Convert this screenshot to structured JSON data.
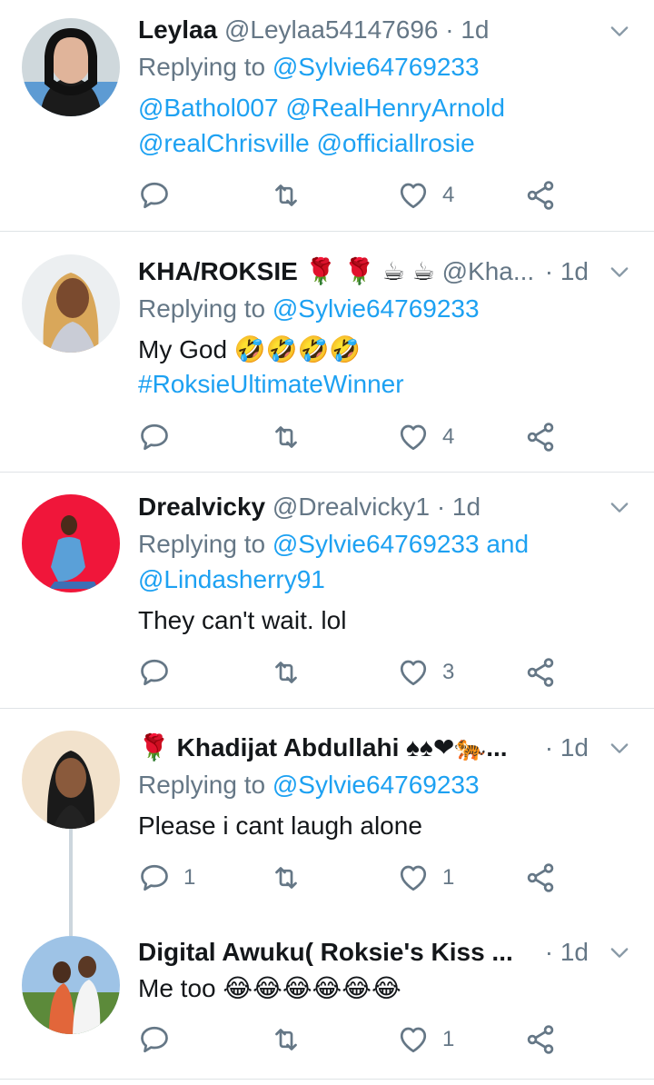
{
  "tweets": [
    {
      "name": "Leylaa",
      "handle": "@Leylaa54147696",
      "time": "· 1d",
      "replying_prefix": "Replying to",
      "replying_to": "@Sylvie64769233",
      "lines": [
        "@Bathol007 @RealHenryArnold",
        "@realChrisville @officiallrosie"
      ],
      "reply_count": "",
      "retweet_count": "",
      "like_count": "4"
    },
    {
      "name": "KHA/ROKSIE 🌹 🌹 ☕ ☕",
      "handle": "@Kha...",
      "time": "· 1d",
      "replying_prefix": "Replying to",
      "replying_to": "@Sylvie64769233",
      "text": "My God 🤣🤣🤣🤣",
      "hashtag": "#RoksieUltimateWinner",
      "reply_count": "",
      "retweet_count": "",
      "like_count": "4"
    },
    {
      "name": "Drealvicky",
      "handle": "@Drealvicky1",
      "time": "· 1d",
      "replying_prefix": "Replying to",
      "replying_to": "@Sylvie64769233 and",
      "replying_to_2": "@Lindasherry91",
      "text": "They can't wait. lol",
      "reply_count": "",
      "retweet_count": "",
      "like_count": "3"
    },
    {
      "name": "🌹 Khadijat Abdullahi ♠♠❤🐅...",
      "time": "· 1d",
      "replying_prefix": "Replying to",
      "replying_to": "@Sylvie64769233",
      "text": "Please i cant laugh alone",
      "reply_count": "1",
      "retweet_count": "",
      "like_count": "1"
    },
    {
      "name": "Digital Awuku( Roksie's Kiss ...",
      "time": "· 1d",
      "text": "Me too 😂😂😂😂😂😂",
      "reply_count": "",
      "retweet_count": "",
      "like_count": "1"
    }
  ],
  "colors": {
    "link": "#1da1f2",
    "secondary": "#657786",
    "divider": "#dfe3e6"
  },
  "icons": [
    "reply-icon",
    "retweet-icon",
    "like-icon",
    "share-icon",
    "chevron-down-icon"
  ]
}
